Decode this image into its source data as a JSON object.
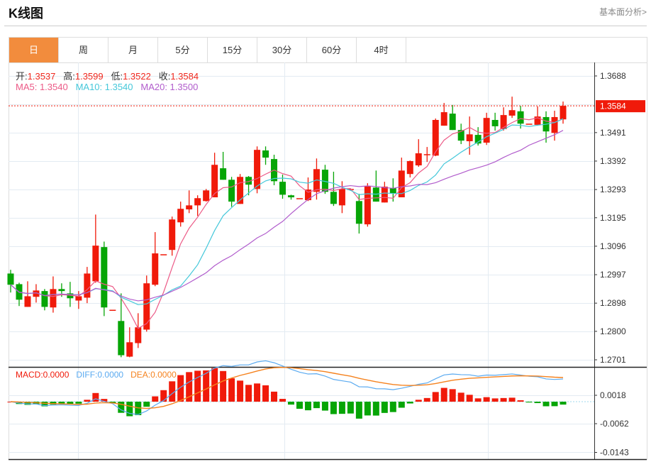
{
  "header": {
    "title": "K线图",
    "link": "基本面分析>"
  },
  "tabs": [
    {
      "label": "日",
      "active": true
    },
    {
      "label": "周"
    },
    {
      "label": "月"
    },
    {
      "label": "5分"
    },
    {
      "label": "15分"
    },
    {
      "label": "30分"
    },
    {
      "label": "60分"
    },
    {
      "label": "4时"
    }
  ],
  "ohlc_legend": {
    "open_label": "开:",
    "open": "1.3537",
    "high_label": "高:",
    "high": "1.3599",
    "low_label": "低:",
    "low": "1.3522",
    "close_label": "收:",
    "close": "1.3584"
  },
  "ma_legend": {
    "ma5": "MA5: 1.3540",
    "ma10": "MA10: 1.3540",
    "ma20": "MA20: 1.3500"
  },
  "macd_legend": {
    "macd": "MACD:0.0000",
    "diff": "DIFF:0.0000",
    "dea": "DEA:0.0000"
  },
  "current_price": "1.3584",
  "colors": {
    "up": "#f01a0a",
    "down": "#06a506",
    "ma5": "#ec5a87",
    "ma10": "#45c8da",
    "ma20": "#b15ccc",
    "diff": "#5aaaf0",
    "dea": "#f5821e",
    "accent": "#f28c3d"
  },
  "chart_data": {
    "type": "candlestick",
    "title": "K线图",
    "price_ticks": [
      "1.3688",
      "1.3491",
      "1.3392",
      "1.3293",
      "1.3195",
      "1.3096",
      "1.2997",
      "1.2898",
      "1.2800",
      "1.2701"
    ],
    "ylim": [
      1.2701,
      1.3688
    ],
    "macd_ticks": [
      "0.0018",
      "-0.0062",
      "-0.0143"
    ],
    "macd_ylim": [
      -0.0143,
      0.0018
    ],
    "ohlc": [
      [
        1.3001,
        1.3014,
        1.2935,
        1.2962
      ],
      [
        1.2964,
        1.2969,
        1.2888,
        1.291
      ],
      [
        1.2885,
        1.2974,
        1.2885,
        1.2922
      ],
      [
        1.292,
        1.2964,
        1.29,
        1.2942
      ],
      [
        1.294,
        1.2947,
        1.2873,
        1.2885
      ],
      [
        1.2883,
        1.2991,
        1.2865,
        1.2947
      ],
      [
        1.2947,
        1.2967,
        1.292,
        1.294
      ],
      [
        1.2932,
        1.2972,
        1.2885,
        1.2915
      ],
      [
        1.2907,
        1.294,
        1.2878,
        1.2922
      ],
      [
        1.2917,
        1.3024,
        1.2898,
        1.3001
      ],
      [
        1.2974,
        1.3206,
        1.2969,
        1.3098
      ],
      [
        1.3093,
        1.3112,
        1.2853,
        1.2883
      ],
      [
        1.2875,
        1.2875,
        1.2875,
        1.2875
      ],
      [
        1.2836,
        1.2932,
        1.271,
        1.2717
      ],
      [
        1.2712,
        1.2814,
        1.271,
        1.2762
      ],
      [
        1.2759,
        1.2863,
        1.2742,
        1.2814
      ],
      [
        1.2806,
        1.2994,
        1.2799,
        1.2967
      ],
      [
        1.2962,
        1.3145,
        1.2957,
        1.3071
      ],
      [
        1.3068,
        1.3068,
        1.3068,
        1.3068
      ],
      [
        1.3083,
        1.3199,
        1.3063,
        1.3189
      ],
      [
        1.3179,
        1.3251,
        1.3164,
        1.3226
      ],
      [
        1.3224,
        1.329,
        1.3211,
        1.3238
      ],
      [
        1.3238,
        1.3273,
        1.3201,
        1.3263
      ],
      [
        1.3253,
        1.3295,
        1.3251,
        1.329
      ],
      [
        1.3266,
        1.3421,
        1.3266,
        1.3379
      ],
      [
        1.3367,
        1.3424,
        1.3327,
        1.3327
      ],
      [
        1.3327,
        1.3337,
        1.3233,
        1.3251
      ],
      [
        1.3243,
        1.3347,
        1.3243,
        1.3337
      ],
      [
        1.3337,
        1.334,
        1.3273,
        1.331
      ],
      [
        1.3295,
        1.3443,
        1.328,
        1.3431
      ],
      [
        1.3429,
        1.3443,
        1.3379,
        1.3404
      ],
      [
        1.3399,
        1.3414,
        1.3308,
        1.3322
      ],
      [
        1.332,
        1.3345,
        1.3261,
        1.3275
      ],
      [
        1.3273,
        1.3275,
        1.3258,
        1.3266
      ],
      [
        1.3263,
        1.3263,
        1.3263,
        1.3263
      ],
      [
        1.3256,
        1.3335,
        1.3253,
        1.3293
      ],
      [
        1.3285,
        1.3401,
        1.3258,
        1.3364
      ],
      [
        1.3362,
        1.3379,
        1.3278,
        1.3285
      ],
      [
        1.3285,
        1.3355,
        1.3236,
        1.3243
      ],
      [
        1.3238,
        1.3322,
        1.3211,
        1.3295
      ],
      [
        1.3295,
        1.3295,
        1.3295,
        1.3295
      ],
      [
        1.3253,
        1.3278,
        1.314,
        1.3174
      ],
      [
        1.3172,
        1.3315,
        1.3164,
        1.3305
      ],
      [
        1.33,
        1.3359,
        1.3251,
        1.3251
      ],
      [
        1.3248,
        1.332,
        1.3248,
        1.3303
      ],
      [
        1.3298,
        1.3332,
        1.3251,
        1.328
      ],
      [
        1.3266,
        1.3404,
        1.3266,
        1.3359
      ],
      [
        1.3347,
        1.3394,
        1.3335,
        1.3392
      ],
      [
        1.3377,
        1.3468,
        1.3372,
        1.3419
      ],
      [
        1.3416,
        1.3441,
        1.3389,
        1.3416
      ],
      [
        1.3411,
        1.354,
        1.3409,
        1.3535
      ],
      [
        1.3515,
        1.3594,
        1.3515,
        1.3562
      ],
      [
        1.3557,
        1.3587,
        1.35,
        1.35
      ],
      [
        1.35,
        1.3522,
        1.3451,
        1.3463
      ],
      [
        1.3461,
        1.3547,
        1.3414,
        1.3485
      ],
      [
        1.3483,
        1.351,
        1.3446,
        1.3453
      ],
      [
        1.3456,
        1.356,
        1.3448,
        1.3542
      ],
      [
        1.3535,
        1.356,
        1.3498,
        1.3513
      ],
      [
        1.3503,
        1.3579,
        1.3498,
        1.3552
      ],
      [
        1.355,
        1.3616,
        1.3542,
        1.3569
      ],
      [
        1.3565,
        1.3584,
        1.3505,
        1.3522
      ],
      [
        1.3522,
        1.3522,
        1.3522,
        1.3522
      ],
      [
        1.3518,
        1.3582,
        1.3515,
        1.3547
      ],
      [
        1.3545,
        1.3565,
        1.3456,
        1.3495
      ],
      [
        1.349,
        1.3567,
        1.3463,
        1.3545
      ],
      [
        1.3537,
        1.3599,
        1.3522,
        1.3584
      ]
    ]
  }
}
